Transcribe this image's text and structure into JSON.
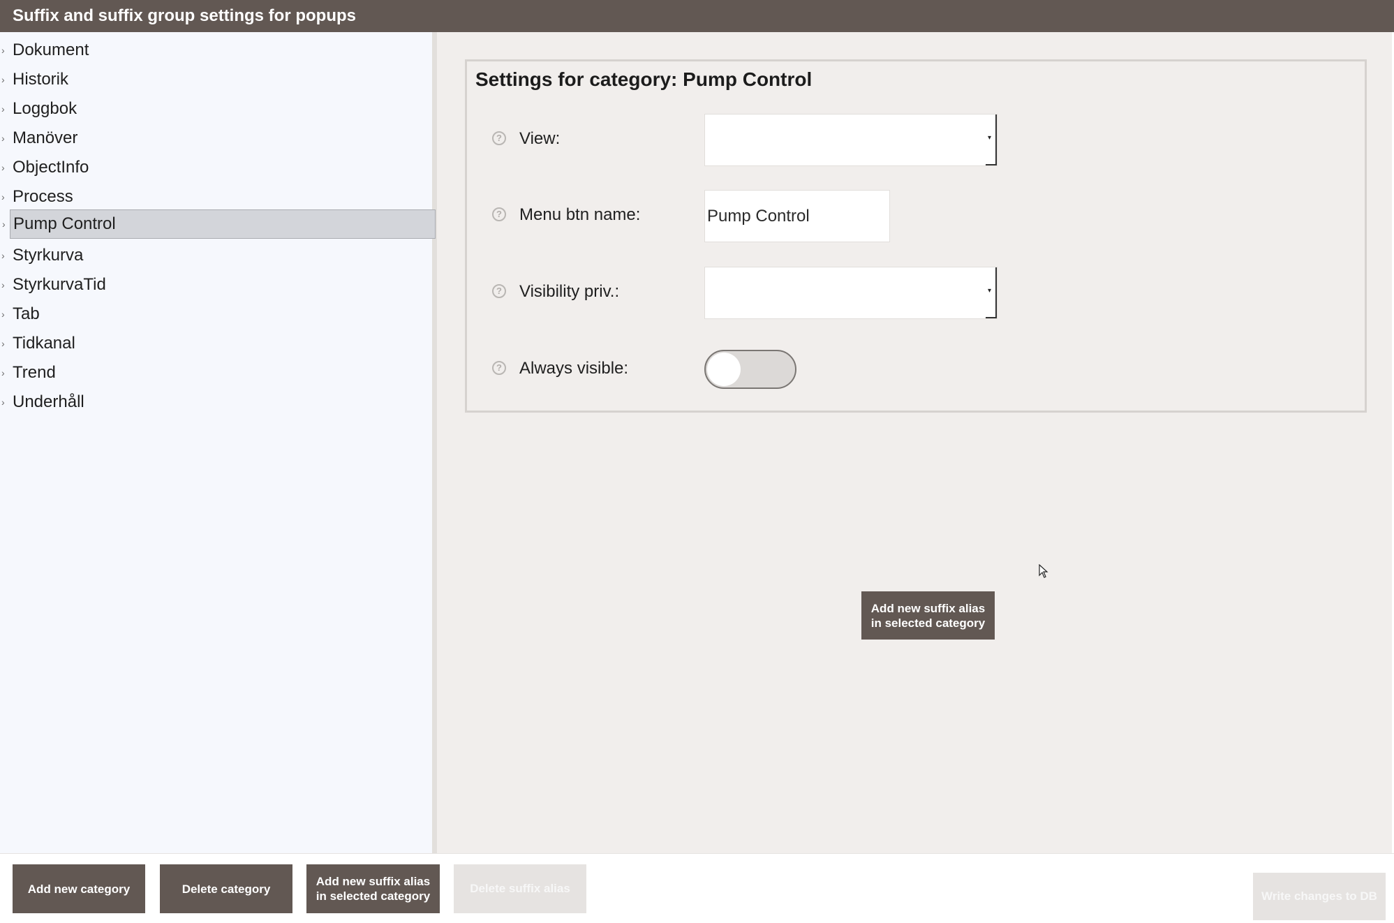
{
  "window": {
    "title": "Suffix and suffix group settings for popups"
  },
  "sidebar": {
    "items": [
      {
        "label": "Dokument"
      },
      {
        "label": "Historik"
      },
      {
        "label": "Loggbok"
      },
      {
        "label": "Manöver"
      },
      {
        "label": "ObjectInfo"
      },
      {
        "label": "Process"
      },
      {
        "label": "Pump Control",
        "selected": true
      },
      {
        "label": "Styrkurva"
      },
      {
        "label": "StyrkurvaTid"
      },
      {
        "label": "Tab"
      },
      {
        "label": "Tidkanal"
      },
      {
        "label": "Trend"
      },
      {
        "label": "Underhåll"
      }
    ]
  },
  "settings": {
    "title": "Settings for category: Pump Control",
    "view_label": "View:",
    "view_value": "",
    "menu_btn_label": "Menu btn name:",
    "menu_btn_value": "Pump Control",
    "visibility_label": "Visibility priv.:",
    "visibility_value": "",
    "always_visible_label": "Always visible:",
    "always_visible_on": false
  },
  "main": {
    "add_suffix_alias_label_line1": "Add new suffix alias",
    "add_suffix_alias_label_line2": "in selected category"
  },
  "footer": {
    "add_category": "Add new category",
    "delete_category": "Delete category",
    "add_suffix_alias_line1": "Add new suffix alias",
    "add_suffix_alias_line2": "in selected category",
    "delete_suffix_alias": "Delete suffix alias",
    "write_changes": "Write changes to DB"
  },
  "colors": {
    "accent": "#625853",
    "sidebar_bg": "#f6f8fd",
    "main_bg": "#f1eeec",
    "selected_bg": "#d3d5da"
  },
  "icons": {
    "help": "question-circle-icon",
    "tree_expand": "chevron-right-icon",
    "dropdown": "caret-down-icon",
    "cursor": "mouse-pointer-icon"
  }
}
